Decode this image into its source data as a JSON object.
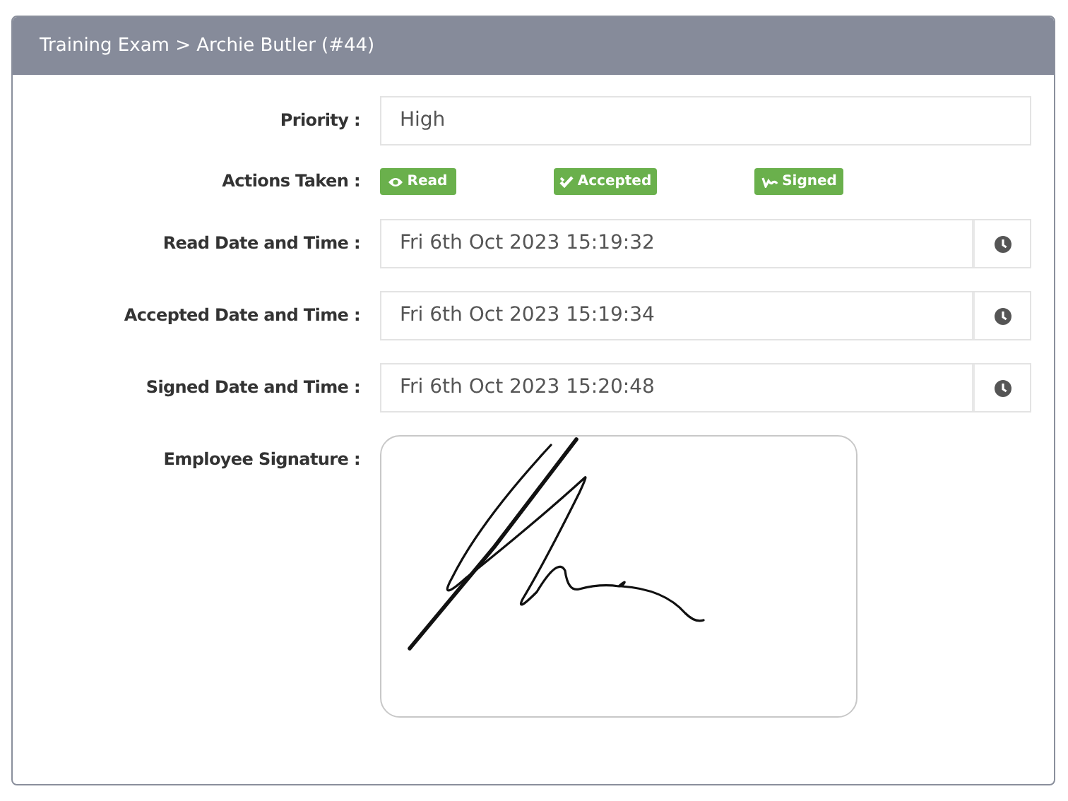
{
  "panel": {
    "title": "Training Exam > Archie Butler (#44)"
  },
  "priority": {
    "label": "Priority :",
    "value": "High"
  },
  "actions": {
    "label": "Actions Taken :",
    "badges": [
      {
        "kind": "read",
        "label": "Read"
      },
      {
        "kind": "accepted",
        "label": "Accepted"
      },
      {
        "kind": "signed",
        "label": "Signed"
      }
    ]
  },
  "dates": [
    {
      "label": "Read Date and Time :",
      "value": "Fri 6th Oct 2023 15:19:32"
    },
    {
      "label": "Accepted Date and Time :",
      "value": "Fri 6th Oct 2023 15:19:34"
    },
    {
      "label": "Signed Date and Time :",
      "value": "Fri 6th Oct 2023 15:20:48"
    }
  ],
  "signature": {
    "label": "Employee Signature :"
  }
}
